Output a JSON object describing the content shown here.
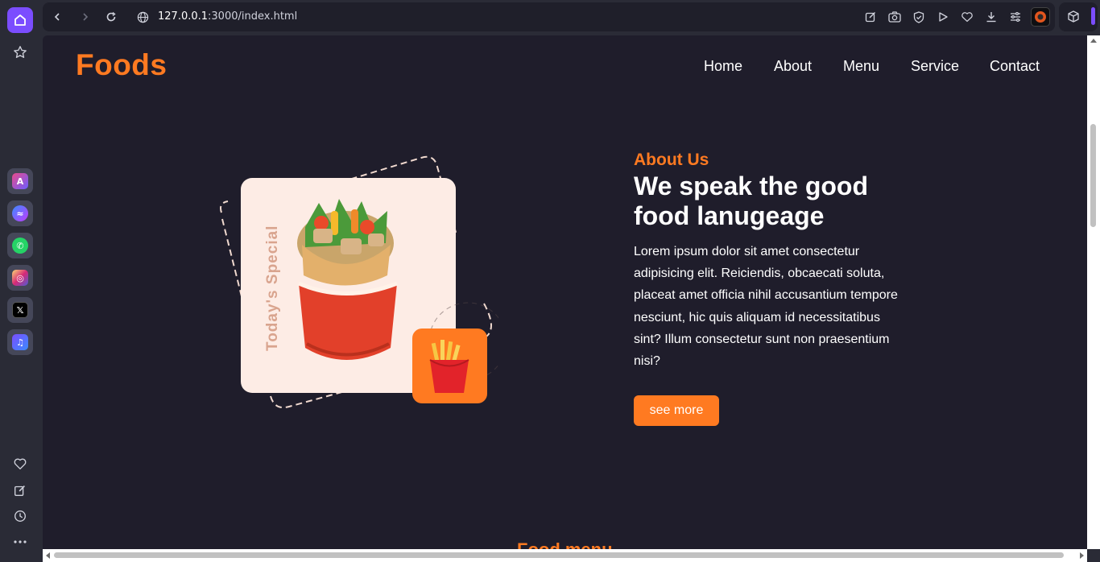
{
  "browser": {
    "url_host": "127.0.0.1",
    "url_rest": ":3000/index.html"
  },
  "site": {
    "logo": "Foods",
    "nav": [
      "Home",
      "About",
      "Menu",
      "Service",
      "Contact"
    ]
  },
  "hero": {
    "badge_text": "Today's Special"
  },
  "about": {
    "kicker": "About Us",
    "title": "We speak the good food lanugeage",
    "body": "Lorem ipsum dolor sit amet consectetur adipisicing elit. Reiciendis, obcaecati soluta, placeat amet officia nihil accusantium tempore nesciunt, hic quis aliquam id necessitatibus sint? Illum consectetur sunt non praesentium nisi?",
    "cta": "see more"
  },
  "next_section": {
    "title": "Food menu"
  },
  "colors": {
    "accent": "#ff7a21",
    "page_bg": "#1f1d2b",
    "chrome_bg": "#2a2b36",
    "browser_accent": "#7b4dff"
  }
}
